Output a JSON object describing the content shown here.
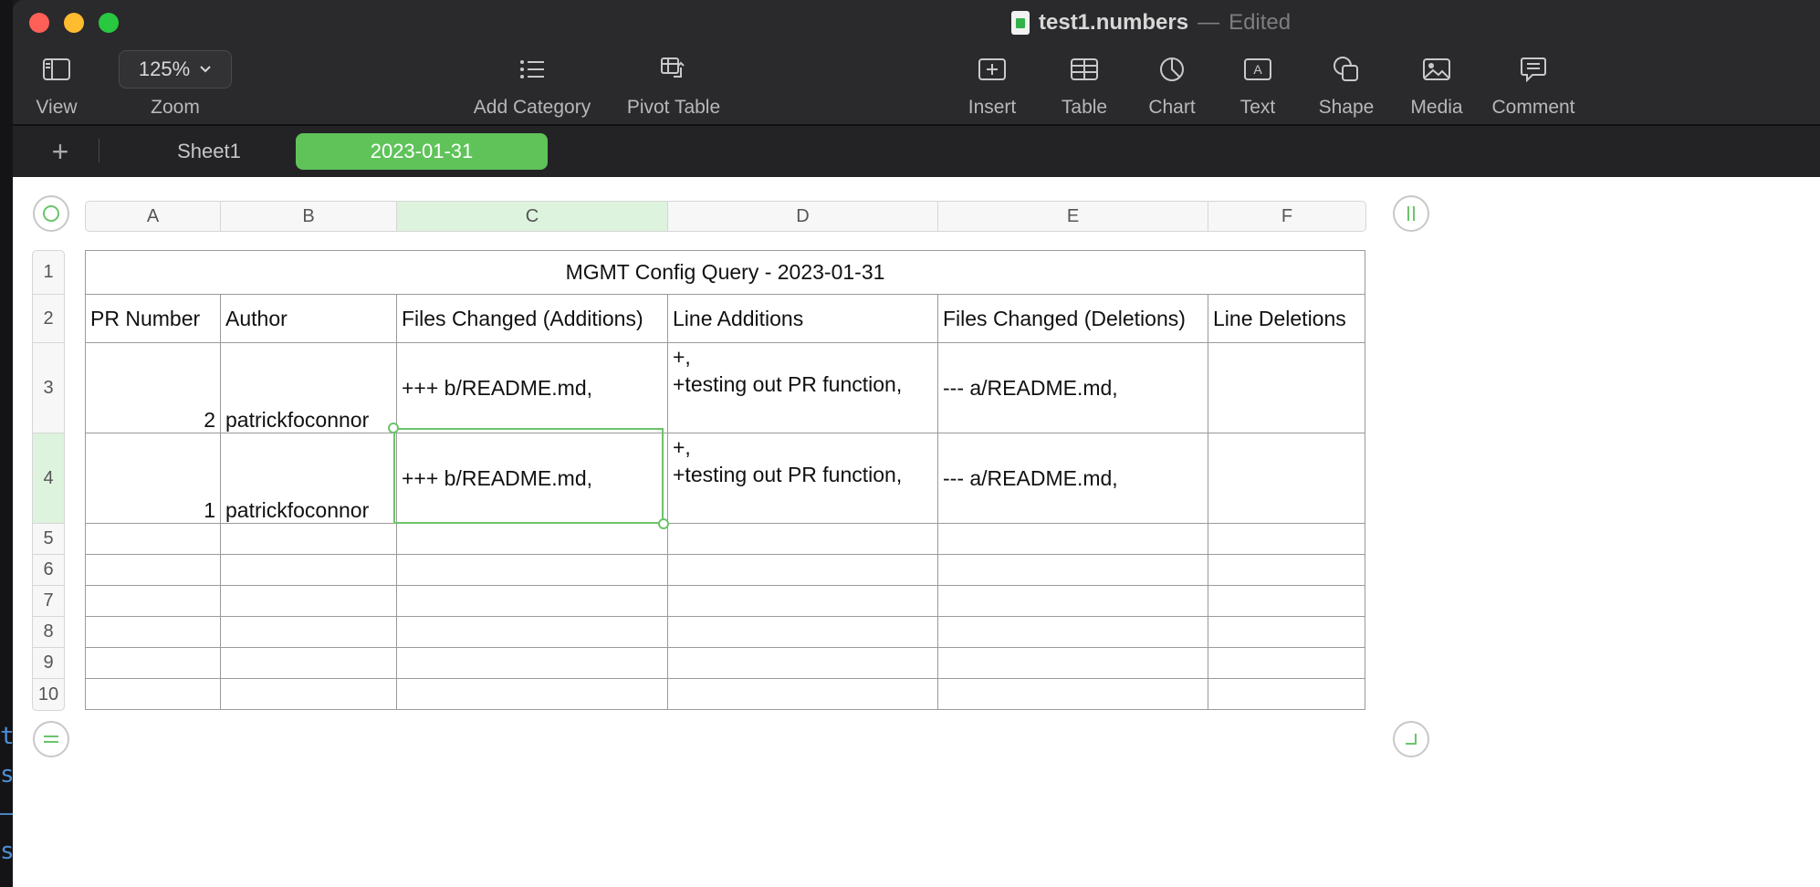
{
  "window": {
    "title": "test1.numbers",
    "separator": "—",
    "status": "Edited"
  },
  "toolbar": {
    "view_label": "View",
    "zoom_value": "125%",
    "zoom_label": "Zoom",
    "add_category_label": "Add Category",
    "pivot_table_label": "Pivot Table",
    "insert_label": "Insert",
    "table_label": "Table",
    "chart_label": "Chart",
    "text_label": "Text",
    "shape_label": "Shape",
    "media_label": "Media",
    "comment_label": "Comment"
  },
  "sheets": {
    "add_label": "+",
    "tabs": [
      "Sheet1",
      "2023-01-31"
    ],
    "active_index": 1
  },
  "spreadsheet": {
    "columns": [
      "A",
      "B",
      "C",
      "D",
      "E",
      "F"
    ],
    "rows": [
      "1",
      "2",
      "3",
      "4",
      "5",
      "6",
      "7",
      "8",
      "9",
      "10"
    ],
    "selected_column": "C",
    "selected_row": "4",
    "table_title": "MGMT Config Query - 2023-01-31",
    "headers": [
      "PR Number",
      "Author",
      "Files Changed (Additions)",
      "Line Additions",
      "Files Changed (Deletions)",
      "Line Deletions"
    ],
    "data_rows": [
      {
        "pr_number": "2",
        "author": "patrickfoconnor",
        "files_added": "+++ b/README.md,",
        "line_additions_1": "+,",
        "line_additions_2": "+testing out PR function,",
        "files_deleted": "--- a/README.md,",
        "line_deletions": ""
      },
      {
        "pr_number": "1",
        "author": "patrickfoconnor",
        "files_added": "+++ b/README.md,",
        "line_additions_1": "+,",
        "line_additions_2": "+testing out PR function,",
        "files_deleted": "--- a/README.md,",
        "line_deletions": ""
      }
    ]
  },
  "background_terminal": {
    "lines": [
      "t",
      "s",
      "—",
      "s"
    ]
  },
  "colors": {
    "accent_green": "#5fc35a",
    "selection_green": "#6bc46b",
    "close": "#fe5f57",
    "minimize": "#febc2e",
    "zoom": "#28c840"
  }
}
